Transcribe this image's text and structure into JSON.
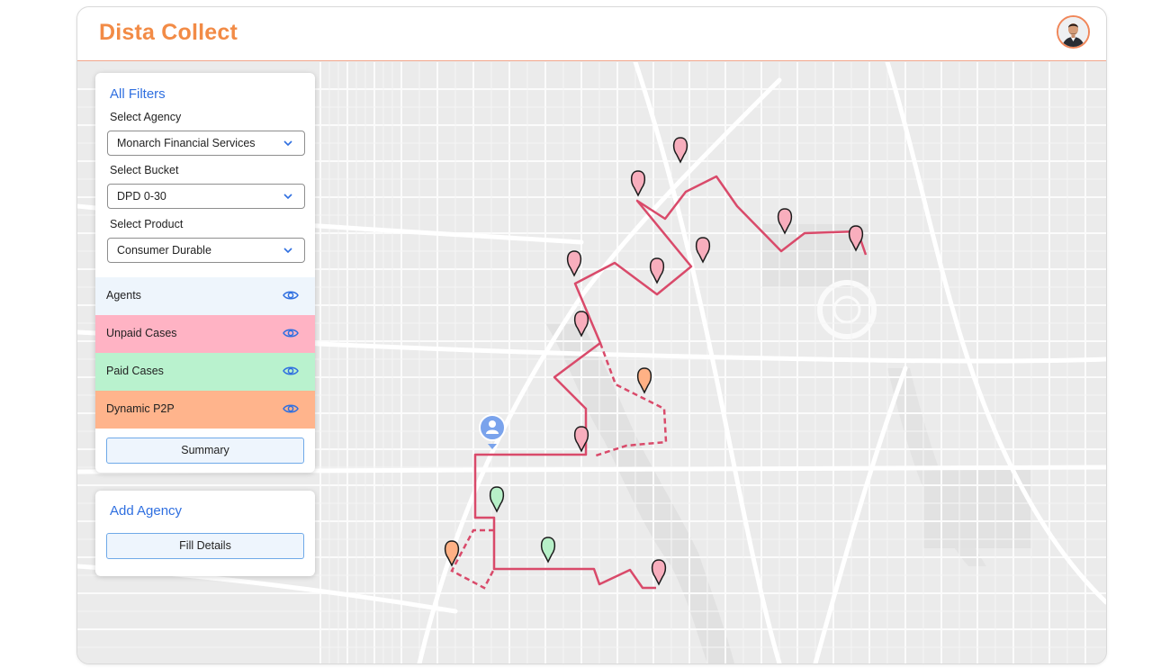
{
  "app": {
    "title": "Dista Collect"
  },
  "filters": {
    "title": "All Filters",
    "agency": {
      "label": "Select Agency",
      "value": "Monarch Financial Services"
    },
    "bucket": {
      "label": "Select Bucket",
      "value": "DPD 0-30"
    },
    "product": {
      "label": "Select Product",
      "value": "Consumer Durable"
    },
    "layers": [
      {
        "label": "Agents",
        "color": "#eef5fc"
      },
      {
        "label": "Unpaid Cases",
        "color": "#ffb3c4"
      },
      {
        "label": "Paid Cases",
        "color": "#b9f2ce"
      },
      {
        "label": "Dynamic P2P",
        "color": "#ffb48c"
      }
    ],
    "summary_label": "Summary"
  },
  "add_agency": {
    "title": "Add Agency",
    "button_label": "Fill Details"
  },
  "colors": {
    "accent": "#f28b46",
    "link_blue": "#2f6fe0",
    "route": "#d94a6a",
    "unpaid_pin": "#f8aebd",
    "paid_pin": "#b7f0c8",
    "p2p_pin": "#ffb185",
    "agent_pin": "#6f9be8"
  },
  "icons": [
    "chevron-down-icon",
    "eye-icon",
    "map-pin-icon",
    "agent-location-icon",
    "user-avatar"
  ]
}
